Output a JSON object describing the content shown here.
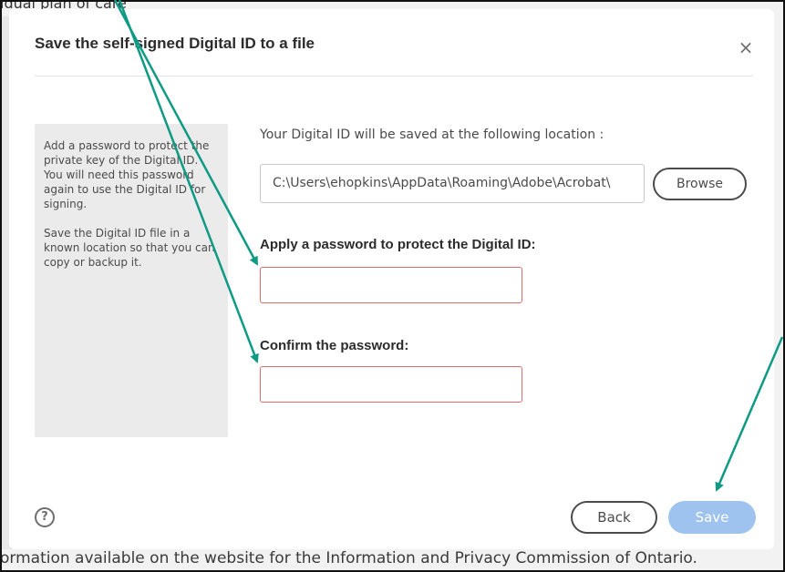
{
  "background": {
    "top_text": "idual plan of care",
    "bottom_text": "ormation available on the website for the Information and Privacy Commission of Ontario."
  },
  "dialog": {
    "title": "Save the self-signed Digital ID to a file",
    "close_glyph": "×",
    "help_panel": {
      "paragraph1": "Add a password to protect the private key of the Digital ID. You will need this password again to use the Digital ID for signing.",
      "paragraph2": "Save the Digital ID file in a known location so that you can copy or backup it."
    },
    "location_label": "Your Digital ID will be saved at the following location :",
    "path_value": "C:\\Users\\ehopkins\\AppData\\Roaming\\Adobe\\Acrobat\\",
    "browse_label": "Browse",
    "password_label": "Apply a password to protect the Digital ID:",
    "password_value": "",
    "confirm_label": "Confirm the password:",
    "confirm_value": "",
    "help_glyph": "?",
    "back_label": "Back",
    "save_label": "Save"
  },
  "colors": {
    "accent_arrow": "#0f9a84",
    "save_button_disabled": "#9dc3ee",
    "input_error_border": "#e06c6c"
  },
  "icons": {
    "close": "close-icon",
    "help": "help-circle-icon"
  }
}
